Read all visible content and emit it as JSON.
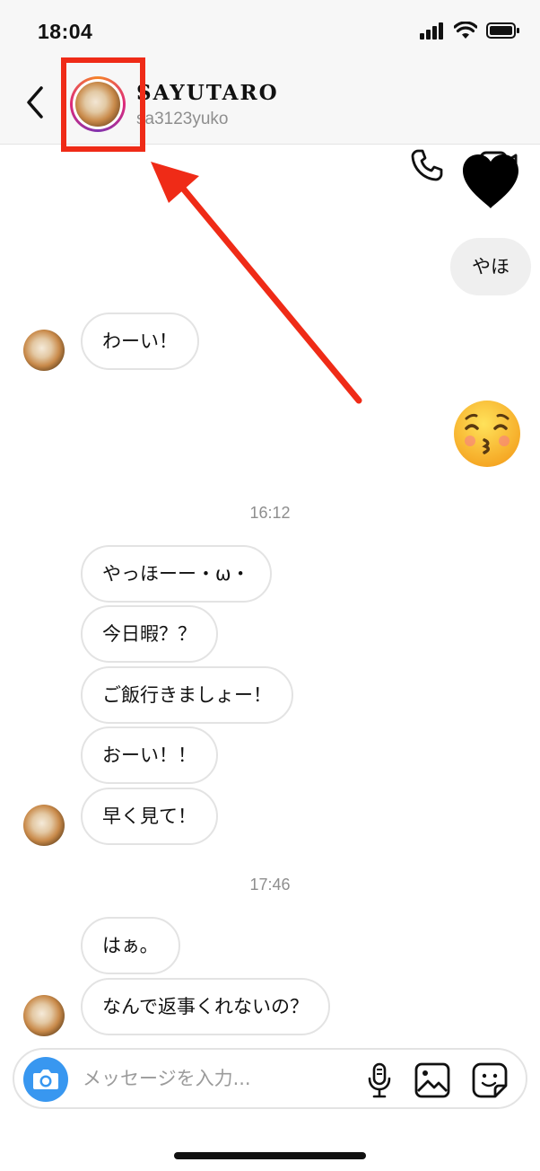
{
  "status_bar": {
    "time": "18:04"
  },
  "header": {
    "username": "SAYUTARO",
    "handle": "sa3123yuko"
  },
  "messages": {
    "me_text_1": "やほ",
    "them_1": "わーい！",
    "time_1": "16:12",
    "them_2": "やっほーー・ω・",
    "them_3": "今日暇？？",
    "them_4": "ご飯行きましょー！",
    "them_5": "おーい！！",
    "them_6": "早く見て！",
    "time_2": "17:46",
    "them_7": "はぁ。",
    "them_8": "なんで返事くれないの？"
  },
  "composer": {
    "placeholder": "メッセージを入力..."
  },
  "colors": {
    "accent": "#3897f0",
    "annotation": "#ef2b17",
    "bubble_border": "#e3e3e3",
    "bubble_me": "#efefef"
  },
  "icons": [
    "back-icon",
    "phone-icon",
    "video-camera-icon",
    "heart-icon",
    "kissing-face-icon",
    "camera-icon",
    "microphone-icon",
    "gallery-icon",
    "sticker-icon"
  ]
}
